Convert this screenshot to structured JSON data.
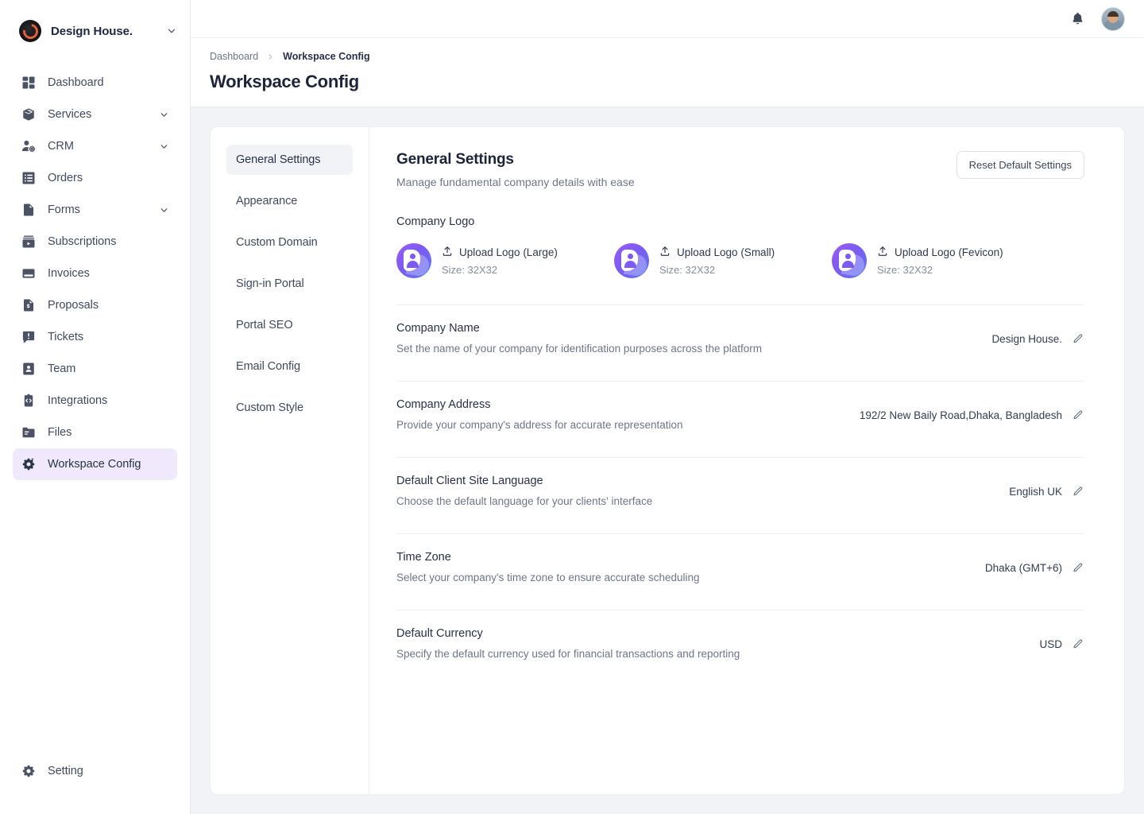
{
  "sidebar": {
    "brand": {
      "name": "Design House.",
      "logo_icon": "brand-circle-logo",
      "chevron_icon": "chevron-down-icon"
    },
    "items": [
      {
        "label": "Dashboard",
        "icon": "dashboard-grid-icon",
        "expandable": false,
        "active": false
      },
      {
        "label": "Services",
        "icon": "package-box-icon",
        "expandable": true,
        "active": false
      },
      {
        "label": "CRM",
        "icon": "user-gear-icon",
        "expandable": true,
        "active": false
      },
      {
        "label": "Orders",
        "icon": "list-table-icon",
        "expandable": false,
        "active": false
      },
      {
        "label": "Forms",
        "icon": "document-icon",
        "expandable": true,
        "active": false
      },
      {
        "label": "Subscriptions",
        "icon": "subscriptions-icon",
        "expandable": false,
        "active": false
      },
      {
        "label": "Invoices",
        "icon": "invoice-card-icon",
        "expandable": false,
        "active": false
      },
      {
        "label": "Proposals",
        "icon": "proposal-dollar-icon",
        "expandable": false,
        "active": false
      },
      {
        "label": "Tickets",
        "icon": "ticket-alert-icon",
        "expandable": false,
        "active": false
      },
      {
        "label": "Team",
        "icon": "team-contact-icon",
        "expandable": false,
        "active": false
      },
      {
        "label": "Integrations",
        "icon": "integrations-code-icon",
        "expandable": false,
        "active": false
      },
      {
        "label": "Files",
        "icon": "folder-icon",
        "expandable": false,
        "active": false
      },
      {
        "label": "Workspace Config",
        "icon": "gear-sparkle-icon",
        "expandable": false,
        "active": true
      }
    ],
    "footer": {
      "label": "Setting",
      "icon": "gear-icon"
    },
    "active_bg": "#f0e8fb"
  },
  "topbar": {
    "notification_icon": "bell-icon",
    "avatar_icon": "user-avatar"
  },
  "page": {
    "breadcrumb": {
      "parent": "Dashboard",
      "separator_icon": "chevron-right-icon",
      "current": "Workspace Config"
    },
    "title": "Workspace Config"
  },
  "settings_tabs": [
    {
      "label": "General Settings",
      "active": true
    },
    {
      "label": "Appearance",
      "active": false
    },
    {
      "label": "Custom Domain",
      "active": false
    },
    {
      "label": "Sign-in Portal",
      "active": false
    },
    {
      "label": "Portal SEO",
      "active": false
    },
    {
      "label": "Email Config",
      "active": false
    },
    {
      "label": "Custom Style",
      "active": false
    }
  ],
  "panel": {
    "title": "General Settings",
    "subtitle": "Manage fundamental company details with ease",
    "reset_label": "Reset Default Settings",
    "logo_section_label": "Company Logo",
    "logos": [
      {
        "upload_label": "Upload Logo (Large)",
        "size_label": "Size: 32X32",
        "upload_icon": "upload-icon",
        "logo_icon": "company-logo-mark"
      },
      {
        "upload_label": "Upload Logo (Small)",
        "size_label": "Size: 32X32",
        "upload_icon": "upload-icon",
        "logo_icon": "company-logo-mark"
      },
      {
        "upload_label": "Upload Logo (Fevicon)",
        "size_label": "Size: 32X32",
        "upload_icon": "upload-icon",
        "logo_icon": "company-logo-mark"
      }
    ],
    "rows": [
      {
        "title": "Company Name",
        "description": "Set the name of your company for identification purposes across the platform",
        "value": "Design House.",
        "edit_icon": "pencil-icon"
      },
      {
        "title": "Company Address",
        "description": "Provide your company's address for accurate representation",
        "value": "192/2 New Baily Road,Dhaka, Bangladesh",
        "edit_icon": "pencil-icon"
      },
      {
        "title": "Default Client Site Language",
        "description": "Choose the default language for your clients' interface",
        "value": "English UK",
        "edit_icon": "pencil-icon"
      },
      {
        "title": "Time Zone",
        "description": "Select your company's time zone to ensure accurate scheduling",
        "value": "Dhaka (GMT+6)",
        "edit_icon": "pencil-icon"
      },
      {
        "title": "Default Currency",
        "description": "Specify the default currency used for financial transactions and reporting",
        "value": "USD",
        "edit_icon": "pencil-icon"
      }
    ]
  },
  "colors": {
    "accent_purple": "#8b5cf6",
    "active_nav_bg": "#f0e8fb",
    "page_bg": "#f1f3f7",
    "text_dark": "#1d2439",
    "text_muted": "#6e7689"
  }
}
